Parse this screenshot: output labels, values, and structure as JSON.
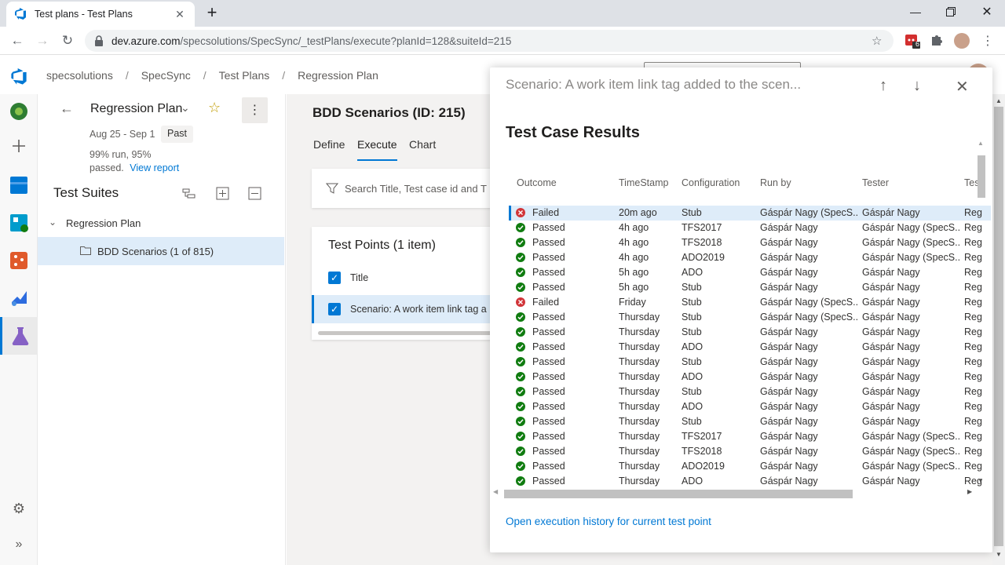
{
  "browser": {
    "tab_title": "Test plans - Test Plans",
    "url_host": "dev.azure.com",
    "url_path": "/specsolutions/SpecSync/_testPlans/execute?planId=128&suiteId=215",
    "ext_badge": "6"
  },
  "breadcrumb": [
    "specsolutions",
    "SpecSync",
    "Test Plans",
    "Regression Plan"
  ],
  "plan": {
    "name": "Regression Plan",
    "dates": "Aug 25 - Sep 1",
    "status": "Past",
    "stats_line1": "99% run, 95%",
    "stats_line2": "passed.",
    "report_link": "View report"
  },
  "suites": {
    "heading": "Test Suites",
    "root": "Regression Plan",
    "child": "BDD Scenarios (1 of 815)"
  },
  "main": {
    "title": "BDD Scenarios (ID: 215)",
    "tabs": [
      "Define",
      "Execute",
      "Chart"
    ],
    "filter_placeholder": "Search Title, Test case id and T",
    "points_title": "Test Points (1 item)",
    "col_title": "Title",
    "point_row": "Scenario: A work item link tag a"
  },
  "panel": {
    "title": "Scenario: A work item link tag added to the scen...",
    "section": "Test Case Results",
    "columns": [
      "Outcome",
      "TimeStamp",
      "Configuration",
      "Run by",
      "Tester",
      "Test"
    ],
    "rows": [
      [
        "Failed",
        "20m ago",
        "Stub",
        "Gáspár Nagy (SpecS...",
        "Gáspár Nagy",
        "Reg"
      ],
      [
        "Passed",
        "4h ago",
        "TFS2017",
        "Gáspár Nagy",
        "Gáspár Nagy (SpecS...",
        "Reg"
      ],
      [
        "Passed",
        "4h ago",
        "TFS2018",
        "Gáspár Nagy",
        "Gáspár Nagy (SpecS...",
        "Reg"
      ],
      [
        "Passed",
        "4h ago",
        "ADO2019",
        "Gáspár Nagy",
        "Gáspár Nagy (SpecS...",
        "Reg"
      ],
      [
        "Passed",
        "5h ago",
        "ADO",
        "Gáspár Nagy",
        "Gáspár Nagy",
        "Reg"
      ],
      [
        "Passed",
        "5h ago",
        "Stub",
        "Gáspár Nagy",
        "Gáspár Nagy",
        "Reg"
      ],
      [
        "Failed",
        "Friday",
        "Stub",
        "Gáspár Nagy (SpecS...",
        "Gáspár Nagy",
        "Reg"
      ],
      [
        "Passed",
        "Thursday",
        "Stub",
        "Gáspár Nagy (SpecS...",
        "Gáspár Nagy",
        "Reg"
      ],
      [
        "Passed",
        "Thursday",
        "Stub",
        "Gáspár Nagy",
        "Gáspár Nagy",
        "Reg"
      ],
      [
        "Passed",
        "Thursday",
        "ADO",
        "Gáspár Nagy",
        "Gáspár Nagy",
        "Reg"
      ],
      [
        "Passed",
        "Thursday",
        "Stub",
        "Gáspár Nagy",
        "Gáspár Nagy",
        "Reg"
      ],
      [
        "Passed",
        "Thursday",
        "ADO",
        "Gáspár Nagy",
        "Gáspár Nagy",
        "Reg"
      ],
      [
        "Passed",
        "Thursday",
        "Stub",
        "Gáspár Nagy",
        "Gáspár Nagy",
        "Reg"
      ],
      [
        "Passed",
        "Thursday",
        "ADO",
        "Gáspár Nagy",
        "Gáspár Nagy",
        "Reg"
      ],
      [
        "Passed",
        "Thursday",
        "Stub",
        "Gáspár Nagy",
        "Gáspár Nagy",
        "Reg"
      ],
      [
        "Passed",
        "Thursday",
        "TFS2017",
        "Gáspár Nagy",
        "Gáspár Nagy (SpecS...",
        "Reg"
      ],
      [
        "Passed",
        "Thursday",
        "TFS2018",
        "Gáspár Nagy",
        "Gáspár Nagy (SpecS...",
        "Reg"
      ],
      [
        "Passed",
        "Thursday",
        "ADO2019",
        "Gáspár Nagy",
        "Gáspár Nagy (SpecS...",
        "Reg"
      ],
      [
        "Passed",
        "Thursday",
        "ADO",
        "Gáspár Nagy",
        "Gáspár Nagy",
        "Reg"
      ]
    ],
    "open_history": "Open execution history for current test point"
  },
  "colors": {
    "accent": "#0078d4",
    "pass": "#107c10",
    "fail": "#d13438"
  }
}
